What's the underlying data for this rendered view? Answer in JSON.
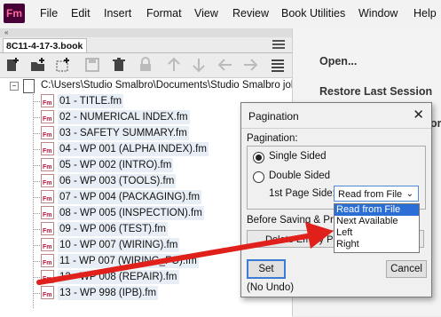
{
  "app": {
    "logo_text": "Fm"
  },
  "menubar": {
    "items": [
      "File",
      "Edit",
      "Insert",
      "Format",
      "View",
      "Review",
      "Book Utilities",
      "Window",
      "Help"
    ]
  },
  "book_panel": {
    "collapse_glyph": "«",
    "tab_label": "8C11-4-17-3.book",
    "root_path": "C:\\Users\\Studio Smalbro\\Documents\\Studio Smalbro jobs\\",
    "files": [
      "01 - TITLE.fm",
      "02 - NUMERICAL INDEX.fm",
      "03 - SAFETY SUMMARY.fm",
      "04 - WP 001 (ALPHA INDEX).fm",
      "05 - WP 002 (INTRO).fm",
      "06 - WP 003 (TOOLS).fm",
      "07 - WP 004 (PACKAGING).fm",
      "08 - WP 005 (INSPECTION).fm",
      "09 - WP 006 (TEST).fm",
      "10 - WP 007 (WIRING).fm",
      "11 - WP 007 (WIRING_FO).fm",
      "12 - WP 008 (REPAIR).fm",
      "13 - WP 998 (IPB).fm"
    ],
    "file_icon_text": "Fm"
  },
  "right_panel": {
    "items": [
      "Open...",
      "Restore Last Session"
    ],
    "partial_text": "or"
  },
  "dialog": {
    "title": "Pagination",
    "close_glyph": "✕",
    "pagination_label": "Pagination:",
    "single_sided": "Single Sided",
    "double_sided": "Double Sided",
    "first_page_side_label": "1st Page Side:",
    "select_value": "Read from File",
    "dropdown_options": [
      "Read from File",
      "Next Available",
      "Left",
      "Right"
    ],
    "before_saving_label": "Before Saving & Printing:",
    "delete_empty_label": "Delete Empty Pages",
    "set_button": "Set",
    "cancel_button": "Cancel",
    "status": "(No Undo)"
  },
  "colors": {
    "annotation_arrow": "#e0201b",
    "selection": "#2b6fd6",
    "logo_bg": "#470137"
  }
}
